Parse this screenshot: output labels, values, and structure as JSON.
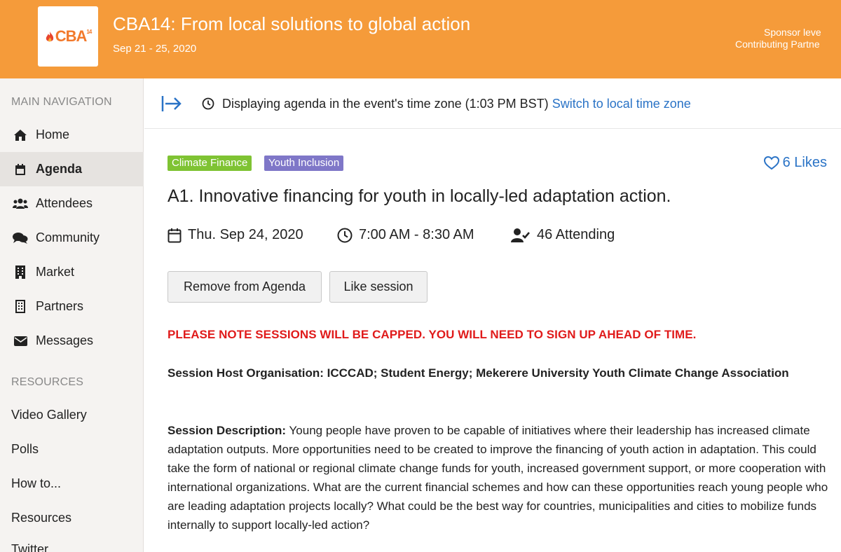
{
  "header": {
    "logo_text": "CBA",
    "logo_sup": "14",
    "title": "CBA14: From local solutions to global action",
    "dates": "Sep 21 - 25, 2020",
    "sponsor_line1": "Sponsor leve",
    "sponsor_line2": "Contributing Partne"
  },
  "sidebar": {
    "main_heading": "MAIN NAVIGATION",
    "items": [
      {
        "label": "Home",
        "icon": "home-icon"
      },
      {
        "label": "Agenda",
        "icon": "calendar-icon"
      },
      {
        "label": "Attendees",
        "icon": "users-icon"
      },
      {
        "label": "Community",
        "icon": "comments-icon"
      },
      {
        "label": "Market",
        "icon": "building-icon"
      },
      {
        "label": "Partners",
        "icon": "building-outline-icon"
      },
      {
        "label": "Messages",
        "icon": "envelope-icon"
      }
    ],
    "resources_heading": "RESOURCES",
    "resources": [
      {
        "label": "Video Gallery"
      },
      {
        "label": "Polls"
      },
      {
        "label": "How to..."
      },
      {
        "label": "Resources"
      },
      {
        "label": "Twitter"
      }
    ]
  },
  "topbar": {
    "timezone_text": "Displaying agenda in the event's time zone (1:03 PM BST)",
    "switch_link": "Switch to local time zone"
  },
  "session": {
    "tags": [
      {
        "label": "Climate Finance",
        "color": "#7fc333"
      },
      {
        "label": "Youth Inclusion",
        "color": "#7f77c8"
      }
    ],
    "likes": "6 Likes",
    "title": "A1. Innovative financing for youth in locally-led adaptation action.",
    "date": "Thu. Sep 24, 2020",
    "time": "7:00 AM - 8:30 AM",
    "attending": "46 Attending",
    "remove_button": "Remove from Agenda",
    "like_button": "Like session",
    "notice": "PLEASE NOTE SESSIONS WILL BE CAPPED. YOU WILL NEED TO SIGN UP AHEAD OF TIME.",
    "host": "Session Host Organisation: ICCCAD; Student Energy; Mekerere University Youth Climate Change Association",
    "description_label": "Session Description:",
    "description": "Young people have proven to be capable of initiatives where their leadership has increased climate adaptation outputs. More opportunities need to be created to improve the financing of youth action in adaptation. This could take the form of national or regional climate change funds for youth, increased government support, or more cooperation with international organizations. What are the current financial schemes and how can these opportunities reach young people who are leading adaptation projects locally? What could be the best way for countries, municipalities and cities to mobilize funds internally to support locally-led action?"
  },
  "colors": {
    "header_bg": "#f59b3a",
    "link": "#2a73c6",
    "notice": "#e01b1b"
  }
}
